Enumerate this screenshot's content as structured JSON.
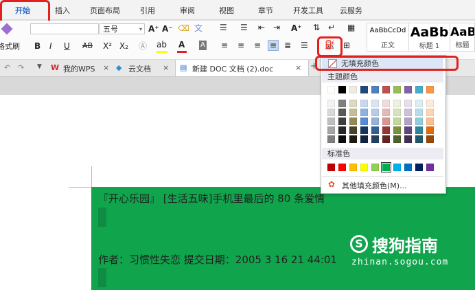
{
  "ribbon_tabs": [
    "开始",
    "插入",
    "页面布局",
    "引用",
    "审阅",
    "视图",
    "章节",
    "开发工具",
    "云服务"
  ],
  "ribbon": {
    "format_painter_label": "格式刷",
    "font_size": "五号",
    "font_grow": "A⁺",
    "font_shrink": "A⁻",
    "clear_format_icon": "eraser-icon",
    "phonetic": "文",
    "bold": "B",
    "italic": "I",
    "underline": "U",
    "strikethrough": "AB",
    "superscript": "X²",
    "subscript": "X₂",
    "styles": [
      {
        "preview": "AaBbCcDd",
        "label": "正文"
      },
      {
        "preview": "AaBb",
        "label": "标题 1"
      },
      {
        "preview": "AaB",
        "label": "标题"
      }
    ]
  },
  "doc_tabs": {
    "mywps": "我的WPS",
    "cloud": "云文档",
    "current_doc": "新建 DOC 文档 (2).doc",
    "new_tab": "+"
  },
  "document": {
    "line1": "『开心乐园』 [生活五味]手机里最后的 80 条爱情",
    "line2": "作者：习惯性失恋   提交日期：2005 3 16 21 44:01"
  },
  "shading_menu": {
    "no_fill": "无填充颜色",
    "theme_colors_label": "主题颜色",
    "standard_colors_label": "标准色",
    "more_colors": "其他填充颜色(M)...",
    "theme_top": [
      "#ffffff",
      "#000000",
      "#eeece1",
      "#1f497d",
      "#4f81bd",
      "#c0504d",
      "#9bbb59",
      "#8064a2",
      "#4bacc6",
      "#f79646"
    ],
    "theme_shades": [
      [
        "#f2f2f2",
        "#7f7f7f",
        "#ddd9c3",
        "#c6d9f0",
        "#dbe5f1",
        "#f2dcdb",
        "#ebf1dd",
        "#e5e0ec",
        "#dbeef3",
        "#fdeada"
      ],
      [
        "#d8d8d8",
        "#595959",
        "#c4bd97",
        "#8db3e2",
        "#b8cce4",
        "#e5b9b7",
        "#d7e3bc",
        "#ccc1d9",
        "#b7dde8",
        "#fbd5b5"
      ],
      [
        "#bfbfbf",
        "#3f3f3f",
        "#938953",
        "#548dd4",
        "#95b3d7",
        "#d99694",
        "#c3d69b",
        "#b2a2c7",
        "#92cddc",
        "#fac08f"
      ],
      [
        "#a5a5a5",
        "#262626",
        "#494429",
        "#17365d",
        "#366092",
        "#953734",
        "#76923c",
        "#5f497a",
        "#31859b",
        "#e36c09"
      ],
      [
        "#7f7f7f",
        "#0c0c0c",
        "#1d1b10",
        "#0f243e",
        "#244061",
        "#632423",
        "#4f6128",
        "#3f3151",
        "#205867",
        "#974806"
      ]
    ],
    "standard": [
      "#c00000",
      "#ff0000",
      "#ffc000",
      "#ffff00",
      "#92d050",
      "#00b050",
      "#00b0f0",
      "#0070c0",
      "#002060",
      "#7030a0"
    ]
  },
  "watermark": {
    "brand": "搜狗指南",
    "url": "zhinan.sogou.com"
  },
  "colors": {
    "highlight_green": "#10a54d",
    "annotation_red": "#e32020",
    "accent_blue": "#2f6fd0"
  }
}
